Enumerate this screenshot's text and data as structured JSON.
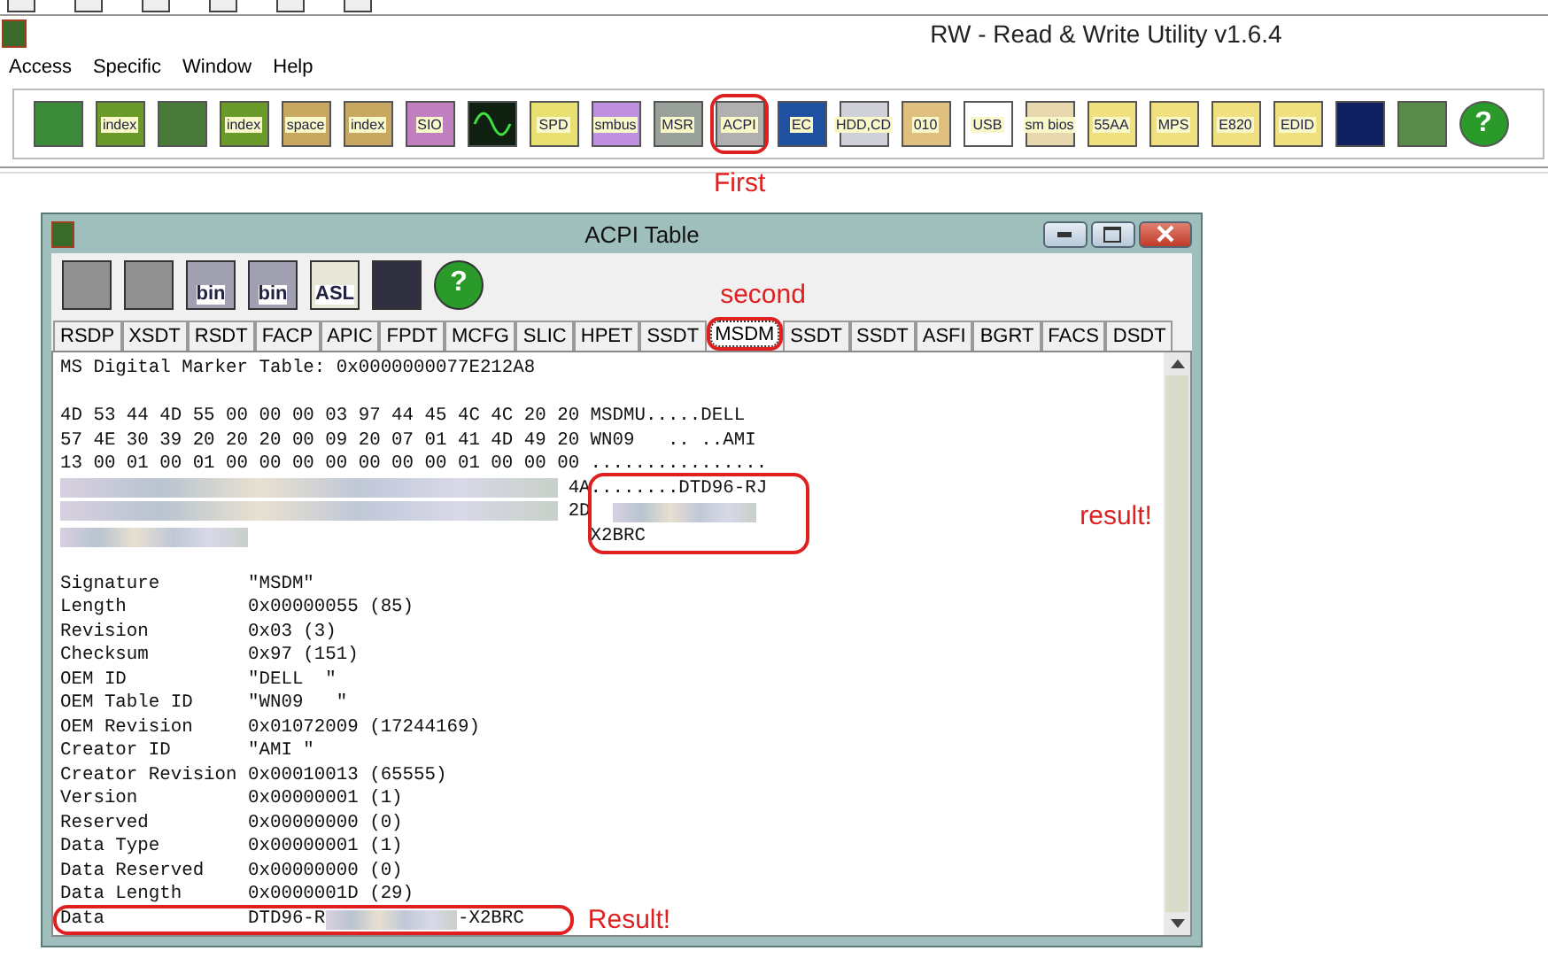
{
  "window": {
    "title": "RW - Read & Write Utility v1.6.4"
  },
  "menu": [
    "Access",
    "Specific",
    "Window",
    "Help"
  ],
  "toolbar": [
    {
      "kind": "card"
    },
    {
      "kind": "index",
      "label": "index"
    },
    {
      "kind": "ram"
    },
    {
      "kind": "index",
      "label": "index"
    },
    {
      "kind": "space",
      "label": "space"
    },
    {
      "kind": "space",
      "label": "index"
    },
    {
      "kind": "sio",
      "label": "SIO"
    },
    {
      "kind": "wave"
    },
    {
      "kind": "spd",
      "label": "SPD"
    },
    {
      "kind": "smbus",
      "label": "smbus"
    },
    {
      "kind": "msr",
      "label": "MSR"
    },
    {
      "kind": "acpi",
      "label": "ACPI",
      "annotation": "First"
    },
    {
      "kind": "ec",
      "label": "EC"
    },
    {
      "kind": "hdd",
      "label": "HDD,CD"
    },
    {
      "kind": "hex",
      "label": "010"
    },
    {
      "kind": "usb",
      "label": "USB"
    },
    {
      "kind": "smbios",
      "label": "sm bios"
    },
    {
      "kind": "chip",
      "label": "55AA"
    },
    {
      "kind": "chip",
      "label": "MPS"
    },
    {
      "kind": "chip",
      "label": "E820"
    },
    {
      "kind": "chip",
      "label": "EDID"
    },
    {
      "kind": "console"
    },
    {
      "kind": "device"
    },
    {
      "kind": "help",
      "label": "?"
    }
  ],
  "acpi_window": {
    "title": "ACPI Table",
    "tools": [
      {
        "kind": "save"
      },
      {
        "kind": "save-all"
      },
      {
        "kind": "bin",
        "label": "bin"
      },
      {
        "kind": "bin-all",
        "label": "bin"
      },
      {
        "kind": "asl",
        "label": "ASL"
      },
      {
        "kind": "find"
      },
      {
        "kind": "help",
        "label": "?"
      }
    ],
    "tabs": [
      {
        "label": "RSDP",
        "selected": false
      },
      {
        "label": "XSDT",
        "selected": false
      },
      {
        "label": "RSDT",
        "selected": false
      },
      {
        "label": "FACP",
        "selected": false
      },
      {
        "label": "APIC",
        "selected": false
      },
      {
        "label": "FPDT",
        "selected": false
      },
      {
        "label": "MCFG",
        "selected": false
      },
      {
        "label": "SLIC",
        "selected": false
      },
      {
        "label": "HPET",
        "selected": false
      },
      {
        "label": "SSDT",
        "selected": false
      },
      {
        "label": "MSDM",
        "selected": true,
        "annotation": "second"
      },
      {
        "label": "SSDT",
        "selected": false
      },
      {
        "label": "SSDT",
        "selected": false
      },
      {
        "label": "ASFI",
        "selected": false
      },
      {
        "label": "BGRT",
        "selected": false
      },
      {
        "label": "FACS",
        "selected": false
      },
      {
        "label": "DSDT",
        "selected": false
      }
    ],
    "heading": "MS Digital Marker Table: 0x0000000077E212A8",
    "hex_rows": [
      {
        "hex": "4D 53 44 4D 55 00 00 00 03 97 44 45 4C 4C 20 20",
        "ascii": "MSDMU.....DELL"
      },
      {
        "hex": "57 4E 30 39 20 20 20 00 09 20 07 01 41 4D 49 20",
        "ascii": "WN09   .. ..AMI"
      },
      {
        "hex": "13 00 01 00 01 00 00 00 00 00 00 00 01 00 00 00",
        "ascii": "................"
      },
      {
        "hex_redacted": true,
        "hex": "4A",
        "ascii": "........DTD96-RJ"
      },
      {
        "hex_redacted": true,
        "hex": "2D",
        "ascii_redacted": true
      },
      {
        "hex_redacted": true,
        "ascii": "X2BRC"
      }
    ],
    "dump_annotation": "result!",
    "fields": [
      {
        "name": "Signature",
        "value": "\"MSDM\""
      },
      {
        "name": "Length",
        "value": "0x00000055 (85)"
      },
      {
        "name": "Revision",
        "value": "0x03 (3)"
      },
      {
        "name": "Checksum",
        "value": "0x97 (151)"
      },
      {
        "name": "OEM ID",
        "value": "\"DELL  \""
      },
      {
        "name": "OEM Table ID",
        "value": "\"WN09   \""
      },
      {
        "name": "OEM Revision",
        "value": "0x01072009 (17244169)"
      },
      {
        "name": "Creator ID",
        "value": "\"AMI \""
      },
      {
        "name": "Creator Revision",
        "value": "0x00010013 (65555)"
      },
      {
        "name": "Version",
        "value": "0x00000001 (1)"
      },
      {
        "name": "Reserved",
        "value": "0x00000000 (0)"
      },
      {
        "name": "Data Type",
        "value": "0x00000001 (1)"
      },
      {
        "name": "Data Reserved",
        "value": "0x00000000 (0)"
      },
      {
        "name": "Data Length",
        "value": "0x0000001D (29)"
      },
      {
        "name": "Data",
        "value": "DTD96-R",
        "value_end": "-X2BRC",
        "redacted": true,
        "annotation": "Result!"
      }
    ]
  }
}
